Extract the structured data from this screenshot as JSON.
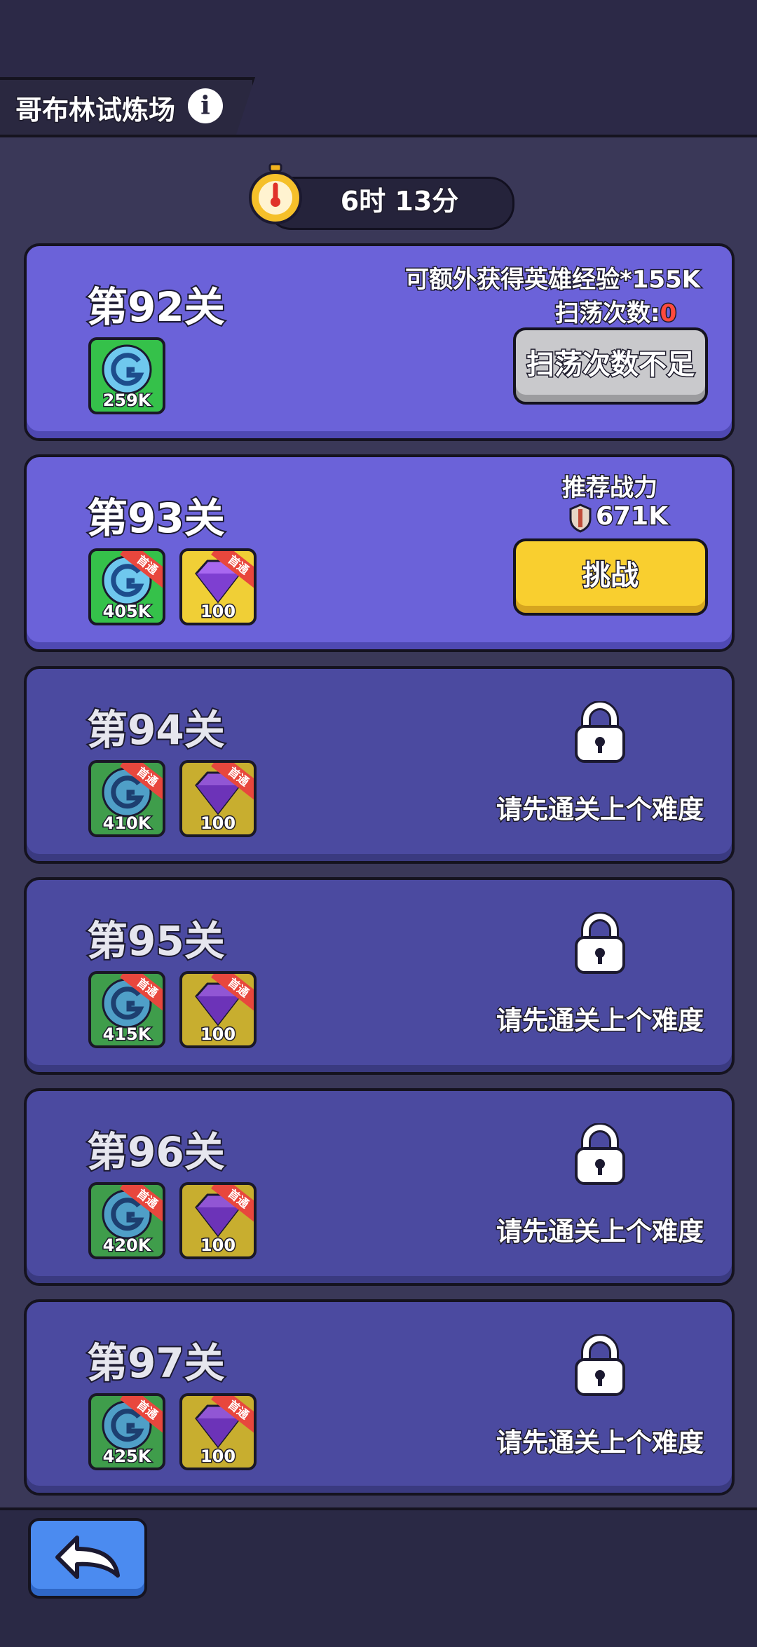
{
  "header": {
    "title": "哥布林试炼场",
    "info_icon": "info-icon"
  },
  "timer": {
    "text": "6时 13分",
    "icon": "stopwatch-icon"
  },
  "cards": [
    {
      "stage": "第92关",
      "rewards": [
        {
          "type": "hero-exp-orb-icon",
          "amount": "259K",
          "first_clear": false
        }
      ],
      "bonus_text": "可额外获得英雄经验*155K",
      "sweep_label": "扫荡次数:",
      "sweep_count": "0",
      "button": "扫荡次数不足",
      "status": "cleared"
    },
    {
      "stage": "第93关",
      "rewards": [
        {
          "type": "hero-exp-orb-icon",
          "amount": "405K",
          "first_clear": true,
          "ribbon": "首通"
        },
        {
          "type": "gem-icon",
          "amount": "100",
          "first_clear": true,
          "ribbon": "首通"
        }
      ],
      "recommend_label": "推荐战力",
      "power": "671K",
      "button": "挑战",
      "status": "current"
    },
    {
      "stage": "第94关",
      "rewards": [
        {
          "type": "hero-exp-orb-icon",
          "amount": "410K",
          "ribbon": "首通"
        },
        {
          "type": "gem-icon",
          "amount": "100",
          "ribbon": "首通"
        }
      ],
      "locked_text": "请先通关上个难度",
      "status": "locked"
    },
    {
      "stage": "第95关",
      "rewards": [
        {
          "type": "hero-exp-orb-icon",
          "amount": "415K",
          "ribbon": "首通"
        },
        {
          "type": "gem-icon",
          "amount": "100",
          "ribbon": "首通"
        }
      ],
      "locked_text": "请先通关上个难度",
      "status": "locked"
    },
    {
      "stage": "第96关",
      "rewards": [
        {
          "type": "hero-exp-orb-icon",
          "amount": "420K",
          "ribbon": "首通"
        },
        {
          "type": "gem-icon",
          "amount": "100",
          "ribbon": "首通"
        }
      ],
      "locked_text": "请先通关上个难度",
      "status": "locked"
    },
    {
      "stage": "第97关",
      "rewards": [
        {
          "type": "hero-exp-orb-icon",
          "amount": "425K",
          "ribbon": "首通"
        },
        {
          "type": "gem-icon",
          "amount": "100",
          "ribbon": "首通"
        }
      ],
      "locked_text": "请先通关上个难度",
      "status": "locked"
    }
  ],
  "footer": {
    "back_icon": "back-arrow-icon"
  }
}
